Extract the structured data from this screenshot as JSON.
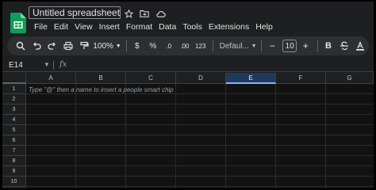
{
  "doc": {
    "title": "Untitled spreadsheet",
    "icons": [
      "star-icon",
      "move-folder-icon",
      "cloud-status-icon"
    ]
  },
  "menu": [
    "File",
    "Edit",
    "View",
    "Insert",
    "Format",
    "Data",
    "Tools",
    "Extensions",
    "Help"
  ],
  "toolbar": {
    "zoom": "100%",
    "currency": "$",
    "percent": "%",
    "decrease_decimal": ".0",
    "increase_decimal": ".00",
    "more_formats": "123",
    "font": "Defaul...",
    "font_size_minus": "−",
    "font_size": "10",
    "font_size_plus": "+",
    "bold": "B"
  },
  "formula_bar": {
    "name_box": "E14",
    "fx": "fx"
  },
  "grid": {
    "columns": [
      "A",
      "B",
      "C",
      "D",
      "E",
      "F",
      "G"
    ],
    "selected_column": "E",
    "rows": [
      "1",
      "2",
      "3",
      "4",
      "5",
      "6",
      "7",
      "8",
      "9",
      "10"
    ],
    "hint": "Type \"@\" then a name to insert a people smart chip"
  },
  "colors": {
    "accent": "#8ab4f8",
    "sheets_green": "#0f9d58",
    "background": "#1e1f20"
  }
}
